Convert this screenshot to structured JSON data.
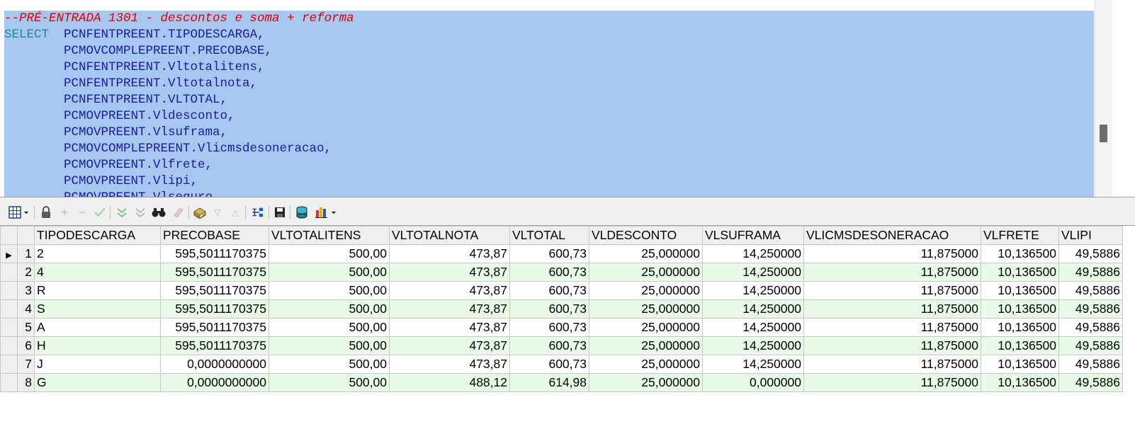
{
  "editor": {
    "comment_line": "--PRÉ-ENTRADA 1301 - descontos e soma + reforma",
    "select_keyword": "SELECT",
    "first_field": "PCNFENTPREENT.TIPODESCARGA,",
    "fields": [
      "PCMOVCOMPLEPREENT.PRECOBASE,",
      "PCNFENTPREENT.Vltotalitens,",
      "PCNFENTPREENT.Vltotalnota,",
      "PCNFENTPREENT.VLTOTAL,",
      "PCMOVPREENT.Vldesconto,",
      "PCMOVPREENT.Vlsuframa,",
      "PCMOVCOMPLEPREENT.Vlicmsdesoneracao,",
      "PCMOVPREENT.Vlfrete,",
      "PCMOVPREENT.Vlipi,",
      "PCMOVPREENT.Vlseguro,"
    ]
  },
  "toolbar": {
    "icons": [
      "grid-menu-icon",
      "lock-icon",
      "add-record-icon",
      "remove-record-icon",
      "post-check-icon",
      "filter-down-icon",
      "filter-double-icon",
      "find-binoculars-icon",
      "clear-eraser-icon",
      "export-icon",
      "move-down-icon",
      "move-up-icon",
      "tree-icon",
      "save-disk-icon",
      "database-icon",
      "chart-menu-icon"
    ]
  },
  "grid": {
    "columns": [
      "TIPODESCARGA",
      "PRECOBASE",
      "VLTOTALITENS",
      "VLTOTALNOTA",
      "VLTOTAL",
      "VLDESCONTO",
      "VLSUFRAMA",
      "VLICMSDESONERACAO",
      "VLFRETE",
      "VLIPI"
    ],
    "rows": [
      {
        "no": "1",
        "cells": [
          "2",
          "595,5011170375",
          "500,00",
          "473,87",
          "600,73",
          "25,000000",
          "14,250000",
          "11,875000",
          "10,136500",
          "49,5886"
        ]
      },
      {
        "no": "2",
        "cells": [
          "4",
          "595,5011170375",
          "500,00",
          "473,87",
          "600,73",
          "25,000000",
          "14,250000",
          "11,875000",
          "10,136500",
          "49,5886"
        ]
      },
      {
        "no": "3",
        "cells": [
          "R",
          "595,5011170375",
          "500,00",
          "473,87",
          "600,73",
          "25,000000",
          "14,250000",
          "11,875000",
          "10,136500",
          "49,5886"
        ]
      },
      {
        "no": "4",
        "cells": [
          "S",
          "595,5011170375",
          "500,00",
          "473,87",
          "600,73",
          "25,000000",
          "14,250000",
          "11,875000",
          "10,136500",
          "49,5886"
        ]
      },
      {
        "no": "5",
        "cells": [
          "A",
          "595,5011170375",
          "500,00",
          "473,87",
          "600,73",
          "25,000000",
          "14,250000",
          "11,875000",
          "10,136500",
          "49,5886"
        ]
      },
      {
        "no": "6",
        "cells": [
          "H",
          "595,5011170375",
          "500,00",
          "473,87",
          "600,73",
          "25,000000",
          "14,250000",
          "11,875000",
          "10,136500",
          "49,5886"
        ]
      },
      {
        "no": "7",
        "cells": [
          "J",
          "0,0000000000",
          "500,00",
          "473,87",
          "600,73",
          "25,000000",
          "14,250000",
          "11,875000",
          "10,136500",
          "49,5886"
        ]
      },
      {
        "no": "8",
        "cells": [
          "G",
          "0,0000000000",
          "500,00",
          "488,12",
          "614,98",
          "25,000000",
          "0,000000",
          "11,875000",
          "10,136500",
          "49,5886"
        ]
      }
    ],
    "current_row_indicator": "▶"
  },
  "colors": {
    "selection": "#a6c8f0",
    "comment": "#e00000",
    "keyword": "#238a8a",
    "identifier": "#1b1b9c",
    "alt_row": "#e6fae6"
  }
}
